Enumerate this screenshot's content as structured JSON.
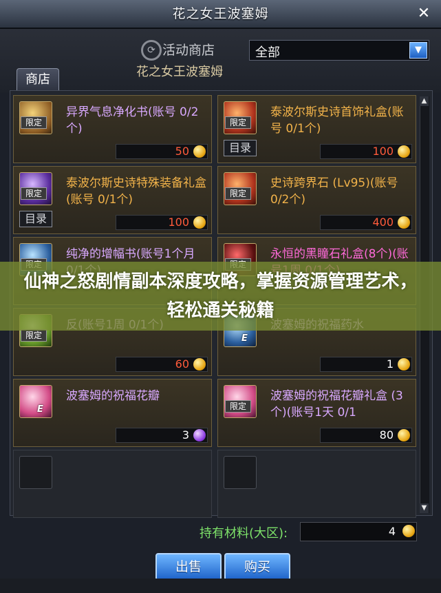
{
  "window": {
    "title": "花之女王波塞姆"
  },
  "header": {
    "subtitle": "活动商店",
    "shop_name": "花之女王波塞姆",
    "filter": {
      "selected": "全部"
    }
  },
  "tabs": [
    {
      "label": "商店"
    }
  ],
  "items": [
    {
      "name": "异界气息净化书(账号 0/2个)",
      "price": "50",
      "limited": "限定",
      "color": "#d9a9ff"
    },
    {
      "name": "泰波尔斯史诗首饰礼盒(账号 0/1个)",
      "price": "100",
      "limited": "限定",
      "catalog": "目录",
      "color": "#f2b34a"
    },
    {
      "name": "泰波尔斯史诗特殊装备礼盒(账号 0/1个)",
      "price": "100",
      "limited": "限定",
      "catalog": "目录",
      "color": "#f2b34a"
    },
    {
      "name": "史诗跨界石 (Lv95)(账号 0/2个)",
      "price": "400",
      "limited": "限定",
      "color": "#f2b34a"
    },
    {
      "name": "纯净的增幅书(账号1个月 0/1个)",
      "price": "",
      "limited": "限定",
      "color": "#d9a9ff"
    },
    {
      "name": "永恒的黑瞳石礼盒(8个)(账号1周 0/1个)",
      "price": "",
      "limited": "限定",
      "color": "#ff6ad9"
    },
    {
      "name": "反(账号1周 0/1个)",
      "price": "60",
      "limited": "限定",
      "color": "#d9a9ff"
    },
    {
      "name": "波塞姆的祝福药水",
      "price": "1",
      "color": "#d9a9ff"
    },
    {
      "name": "波塞姆的祝福花瓣",
      "price": "3",
      "color": "#d9a9ff"
    },
    {
      "name": "波塞姆的祝福花瓣礼盒 (3个)(账号1天 0/1",
      "price": "80",
      "limited": "限定",
      "color": "#d9a9ff"
    }
  ],
  "footer": {
    "materials_label": "持有材料(大区):",
    "materials_value": "4",
    "sell_label": "出售",
    "buy_label": "购买"
  },
  "banner": {
    "text": "仙神之怒剧情副本深度攻略，掌握资源管理艺术，轻松通关秘籍"
  },
  "icons": [
    "refresh-icon",
    "chevron-down-icon",
    "close-icon",
    "gold-coin-icon",
    "purple-coin-icon",
    "scroll-up-icon",
    "scroll-down-icon"
  ],
  "colors": {
    "accent": "#1e63c9",
    "price": "#ff5b3b",
    "materials": "#7ee36a"
  }
}
